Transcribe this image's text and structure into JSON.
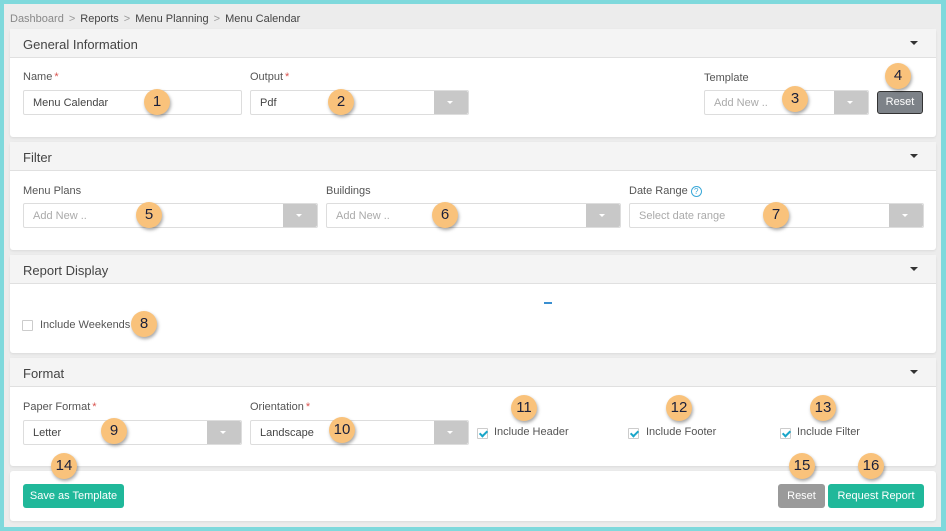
{
  "breadcrumb": [
    "Dashboard",
    "Reports",
    "Menu Planning",
    "Menu Calendar"
  ],
  "general": {
    "title": "General Information",
    "name_label": "Name",
    "name_value": "Menu Calendar",
    "output_label": "Output",
    "output_value": "Pdf",
    "template_label": "Template",
    "template_placeholder": "Add New ..",
    "reset_label": "Reset"
  },
  "filter": {
    "title": "Filter",
    "menu_plans_label": "Menu Plans",
    "menu_plans_placeholder": "Add New ..",
    "buildings_label": "Buildings",
    "buildings_placeholder": "Add New ..",
    "date_range_label": "Date Range",
    "date_range_placeholder": "Select date range",
    "help": "?"
  },
  "display": {
    "title": "Report Display",
    "include_weekends_label": "Include Weekends",
    "include_weekends": false
  },
  "format": {
    "title": "Format",
    "paper_label": "Paper Format",
    "paper_value": "Letter",
    "orientation_label": "Orientation",
    "orientation_value": "Landscape",
    "include_header_label": "Include Header",
    "include_header": true,
    "include_footer_label": "Include Footer",
    "include_footer": true,
    "include_filter_label": "Include Filter",
    "include_filter": true
  },
  "footer": {
    "save_template_label": "Save as Template",
    "reset_label": "Reset",
    "request_label": "Request Report"
  },
  "required_mark": "*",
  "badges": [
    "1",
    "2",
    "3",
    "4",
    "5",
    "6",
    "7",
    "8",
    "9",
    "10",
    "11",
    "12",
    "13",
    "14",
    "15",
    "16"
  ],
  "colors": {
    "accent": "#20b89a",
    "frame": "#7fd9dc",
    "badge": "#f9c27b"
  }
}
